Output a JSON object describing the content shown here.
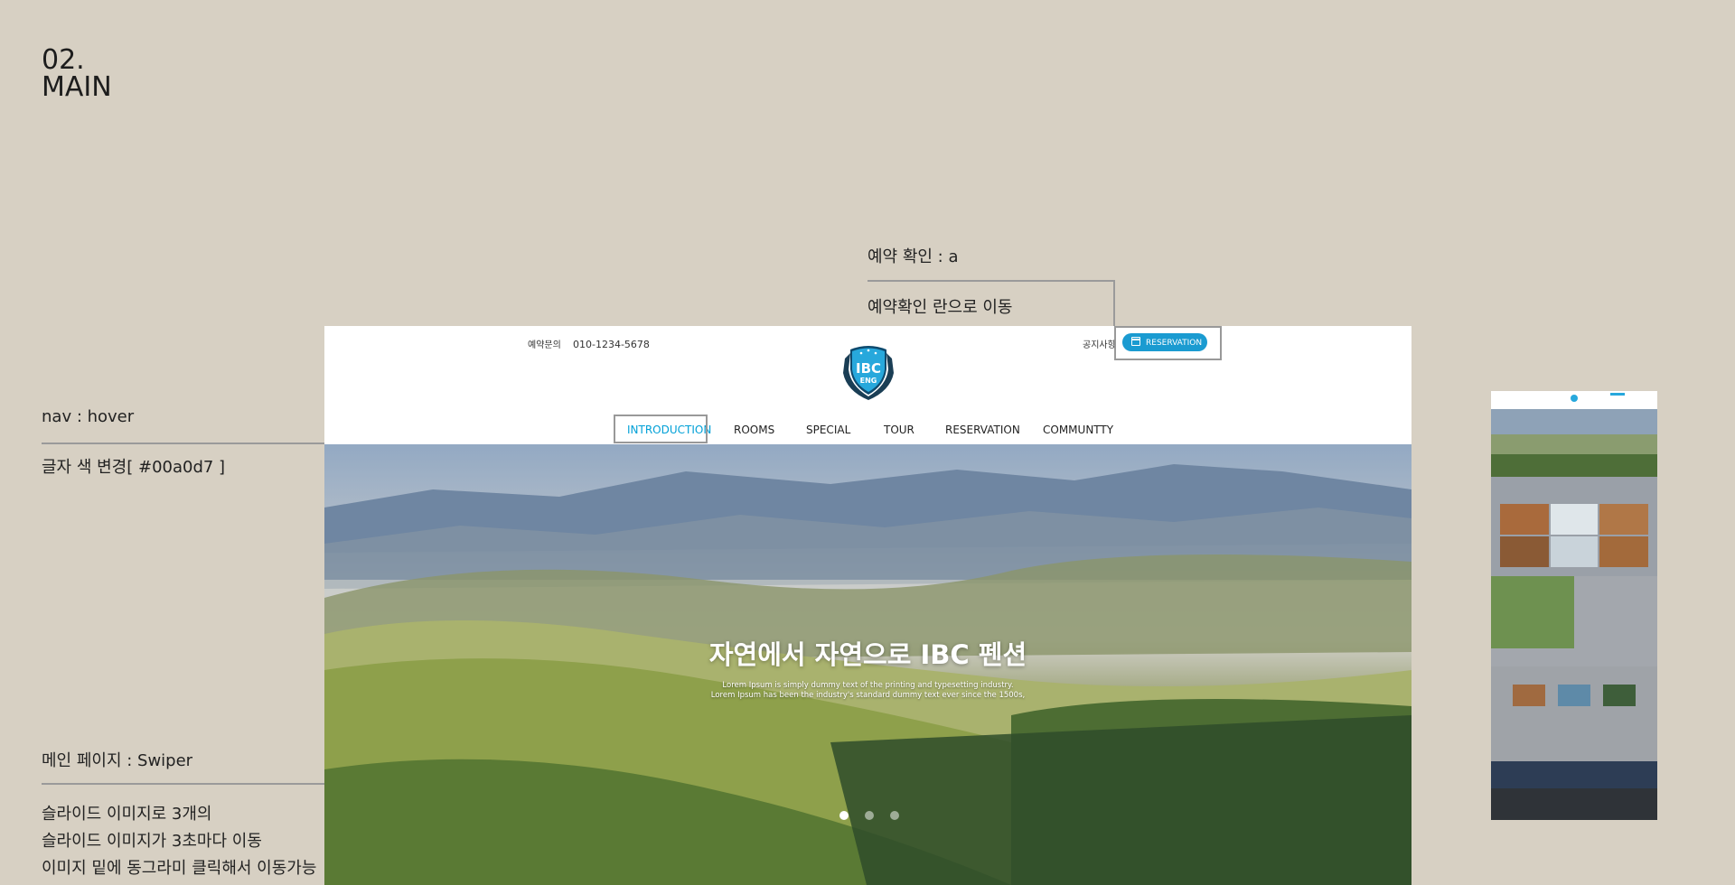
{
  "page_title": {
    "line1": "02.",
    "line2": "MAIN"
  },
  "annotations": {
    "reservation_check": {
      "title": "예약 확인 : a",
      "desc": "예약확인 란으로 이동"
    },
    "nav_hover": {
      "title": "nav : hover",
      "desc": "글자 색 변경[ #00a0d7 ]"
    },
    "main_swiper": {
      "title": "메인 페이지 : Swiper",
      "lines": [
        "슬라이드 이미지로 3개의",
        "슬라이드 이미지가 3초마다 이동",
        "이미지 밑에 동그라미 클릭해서 이동가능"
      ]
    }
  },
  "site": {
    "topbar": {
      "inquiry_label": "예약문의",
      "phone": "010-1234-5678",
      "notice_link": "공지사항",
      "reservation_button": "RESERVATION"
    },
    "logo": {
      "text_main": "IBC",
      "text_sub": "ENG"
    },
    "nav": [
      "INTRODUCTION",
      "ROOMS",
      "SPECIAL",
      "TOUR",
      "RESERVATION",
      "COMMUNTTY"
    ],
    "active_nav_index": 0,
    "accent_color": "#00a0d7",
    "hero": {
      "title": "자연에서 자연으로 IBC 펜션",
      "sub_line1": "Lorem Ipsum is simply dummy text of the printing and typesetting industry.",
      "sub_line2": "Lorem Ipsum has been the industry's standard dummy text ever since the 1500s,",
      "slide_count": 3,
      "active_slide": 0
    }
  }
}
